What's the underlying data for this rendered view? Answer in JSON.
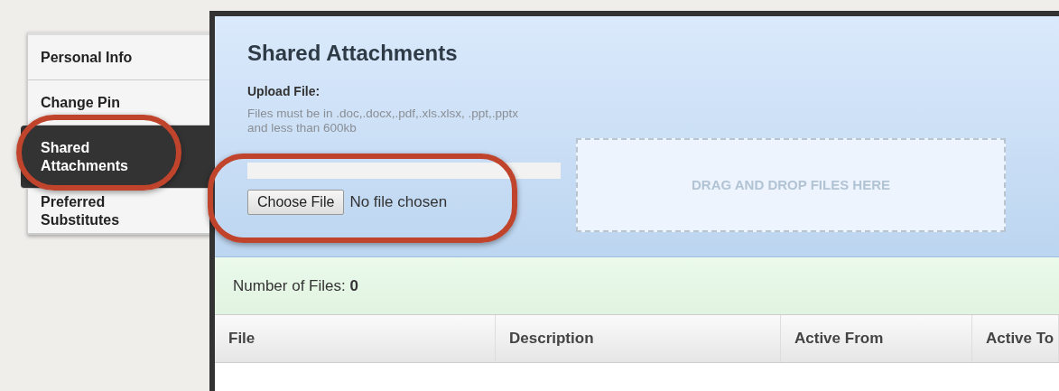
{
  "sidebar": {
    "items": [
      {
        "label": "Personal Info",
        "selected": false
      },
      {
        "label": "Change Pin",
        "selected": false
      },
      {
        "label": "Shared Attachments",
        "selected": true
      },
      {
        "label": "Preferred Substitutes",
        "selected": false
      }
    ]
  },
  "panel": {
    "title": "Shared Attachments",
    "upload_label": "Upload File:",
    "help": "Files must be in .doc,.docx,.pdf,.xls.xlsx, .ppt,.pptx and less than 600kb",
    "progress": {
      "level": 0
    },
    "choose_button": "Choose File",
    "file_status": "No file chosen",
    "drop_zone": "DRAG AND DROP FILES HERE"
  },
  "summary": {
    "label": "Number of Files:",
    "count": "0"
  },
  "table": {
    "columns": [
      "File",
      "Description",
      "Active From",
      "Active To"
    ]
  }
}
